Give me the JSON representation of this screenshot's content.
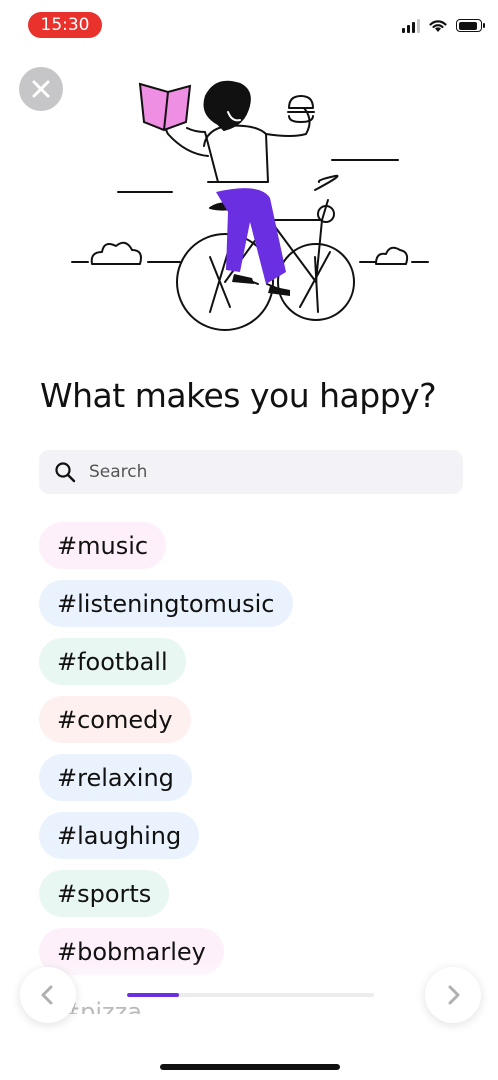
{
  "status_bar": {
    "time": "15:30"
  },
  "title": "What makes you happy?",
  "search": {
    "placeholder": "Search",
    "value": ""
  },
  "tags": [
    {
      "label": "#music",
      "color": "#fdf0fa"
    },
    {
      "label": "#listeningtomusic",
      "color": "#eaf3fd"
    },
    {
      "label": "#football",
      "color": "#e8f7f1"
    },
    {
      "label": "#comedy",
      "color": "#fdf0ee"
    },
    {
      "label": "#relaxing",
      "color": "#eaf3fd"
    },
    {
      "label": "#laughing",
      "color": "#eaf3fd"
    },
    {
      "label": "#sports",
      "color": "#e8f7f1"
    },
    {
      "label": "#bobmarley",
      "color": "#fdf0fa"
    },
    {
      "label": "#pizza",
      "color": "#fdf8e6"
    }
  ],
  "progress": {
    "fraction": 0.21,
    "accent": "#6a2fe0"
  },
  "icons": {
    "close": "close-icon",
    "search": "search-icon",
    "prev": "chevron-left-icon",
    "next": "chevron-right-icon"
  }
}
